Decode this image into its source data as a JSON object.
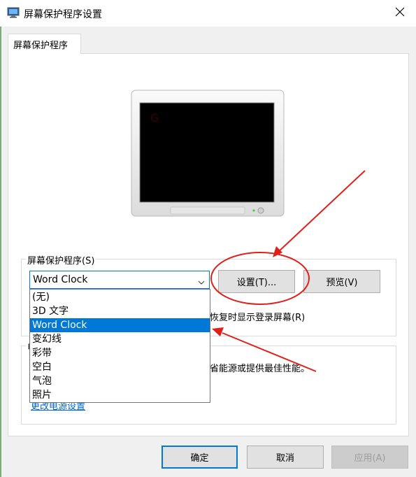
{
  "window": {
    "title": "屏幕保护程序设置"
  },
  "tabs": [
    {
      "label": "屏幕保护程序"
    }
  ],
  "screensaver": {
    "group_label": "屏幕保护程序(S)",
    "selected": "Word Clock",
    "settings_button": "设置(T)...",
    "preview_button": "预览(V)",
    "resume_text": "恢复时显示登录屏幕(R)",
    "dropdown_options": [
      "(无)",
      "3D 文字",
      "Word Clock",
      "变幻线",
      "彩带",
      "空白",
      "气泡",
      "照片"
    ],
    "dropdown_selected_index": 2
  },
  "power": {
    "group_label_fragment": "电",
    "text_fragment": "省能源或提供最佳性能。",
    "link_fragment": "更改电源设置"
  },
  "footer": {
    "ok": "确定",
    "cancel": "取消",
    "apply": "应用(A)"
  },
  "colors": {
    "accent": "#0078d7",
    "annotation": "#e0201b"
  }
}
